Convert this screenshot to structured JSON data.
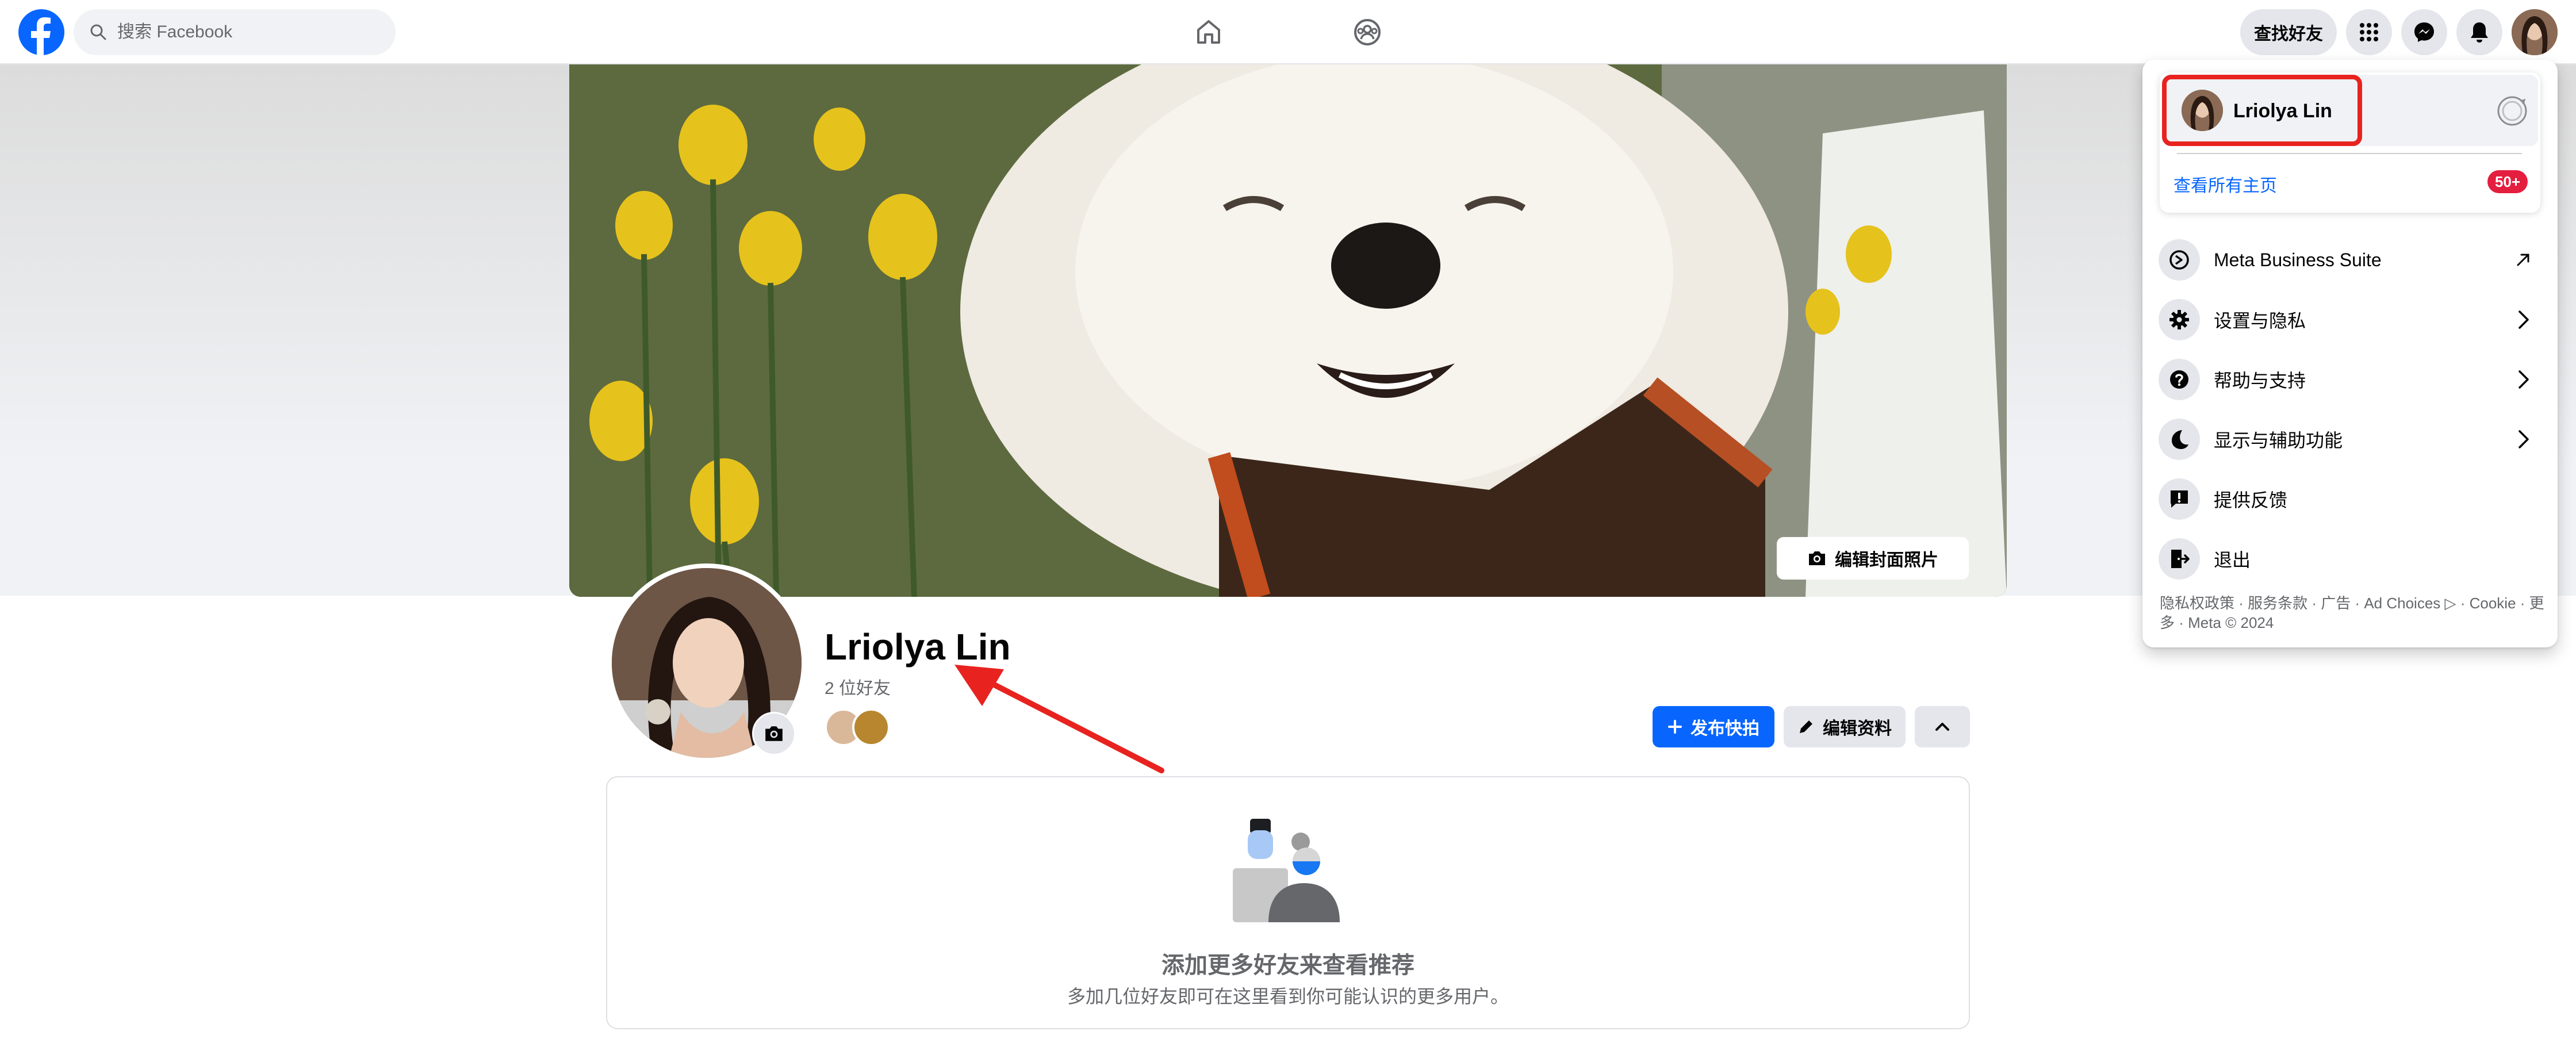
{
  "topbar": {
    "search_placeholder": "搜索 Facebook",
    "find_friends": "查找好友"
  },
  "cover": {
    "edit_label": "编辑封面照片"
  },
  "profile": {
    "name": "Lriolya Lin",
    "friend_count": "2 位好友",
    "publish_label": "发布快拍",
    "edit_label": "编辑资料"
  },
  "suggestions": {
    "title": "添加更多好友来查看推荐",
    "subtitle": "多加几位好友即可在这里看到你可能认识的更多用户。"
  },
  "dropdown": {
    "account_name": "Lriolya Lin",
    "see_all_pages": "查看所有主页",
    "badge": "50+",
    "items": [
      {
        "label": "Meta Business Suite",
        "icon": "meta-business-icon",
        "right": "external-link-icon"
      },
      {
        "label": "设置与隐私",
        "icon": "gear-icon",
        "right": "chevron-right-icon"
      },
      {
        "label": "帮助与支持",
        "icon": "help-icon",
        "right": "chevron-right-icon"
      },
      {
        "label": "显示与辅助功能",
        "icon": "moon-icon",
        "right": "chevron-right-icon"
      },
      {
        "label": "提供反馈",
        "icon": "feedback-icon",
        "right": ""
      },
      {
        "label": "退出",
        "icon": "logout-icon",
        "right": ""
      }
    ],
    "footer": "隐私权政策 · 服务条款 · 广告 · Ad Choices ▷ · Cookie · 更多 · Meta © 2024"
  },
  "colors": {
    "brand_blue": "#0866ff",
    "annotation_red": "#e8231f",
    "badge_red": "#e41e3f"
  }
}
